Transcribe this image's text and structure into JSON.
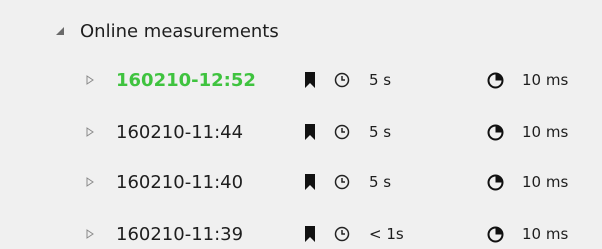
{
  "group": {
    "label": "Online measurements",
    "expanded": true
  },
  "items": [
    {
      "name": "160210-12:52",
      "interval": "5 s",
      "duration": "10 ms",
      "active": true
    },
    {
      "name": "160210-11:44",
      "interval": "5 s",
      "duration": "10 ms",
      "active": false
    },
    {
      "name": "160210-11:40",
      "interval": "5 s",
      "duration": "10 ms",
      "active": false
    },
    {
      "name": "160210-11:39",
      "interval": "< 1s",
      "duration": "10 ms",
      "active": false
    }
  ],
  "icons": {
    "expanded_caret": "triangle-down-right-icon",
    "collapsed_caret": "triangle-right-outline-icon",
    "bookmark": "bookmark-icon",
    "interval": "clock-icon",
    "duration": "pie-clock-icon"
  },
  "colors": {
    "background": "#f0f0f0",
    "text": "#1e1e1e",
    "active": "#3fc33f",
    "caret": "#777777"
  }
}
